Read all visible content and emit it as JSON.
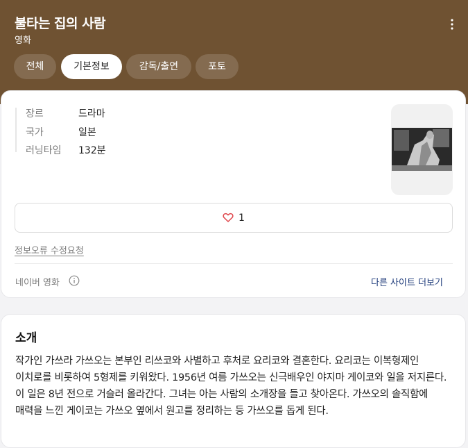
{
  "header": {
    "title": "불타는 집의 사람",
    "subtitle": "영화",
    "more_icon": "more-vertical-icon",
    "tabs": [
      {
        "label": "전체",
        "active": false
      },
      {
        "label": "기본정보",
        "active": true
      },
      {
        "label": "감독/출연",
        "active": false
      },
      {
        "label": "포토",
        "active": false
      }
    ]
  },
  "info": {
    "rows": [
      {
        "label": "장르",
        "value": "드라마"
      },
      {
        "label": "국가",
        "value": "일본"
      },
      {
        "label": "러닝타임",
        "value": "132분"
      }
    ]
  },
  "like": {
    "icon": "heart-icon",
    "count": "1"
  },
  "report_link": "정보오류 수정요청",
  "source": {
    "label": "네이버 영화",
    "info_icon": "info-icon"
  },
  "other_sites_label": "다른 사이트 더보기",
  "intro": {
    "title": "소개",
    "text": "작가인 가쓰라 가쓰오는 본부인 리쓰코와 사별하고 후처로 요리코와 결혼한다. 요리코는 이복형제인 이치로를 비롯하여 5형제를 키워왔다. 1956년 여름 가쓰오는 신극배우인 야지마 게이코와 일을 저지른다. 이 일은 8년 전으로 거슬러 올라간다. 그녀는 아는 사람의 소개장을 들고 찾아온다. 가쓰오의 솔직함에 매력을 느낀 게이코는 가쓰오 옆에서 원고를 정리하는 등 가쓰오를 돕게 된다."
  },
  "colors": {
    "header_bg": "#6f5232",
    "link_blue": "#1d3a7a",
    "heart": "#e0484d"
  }
}
